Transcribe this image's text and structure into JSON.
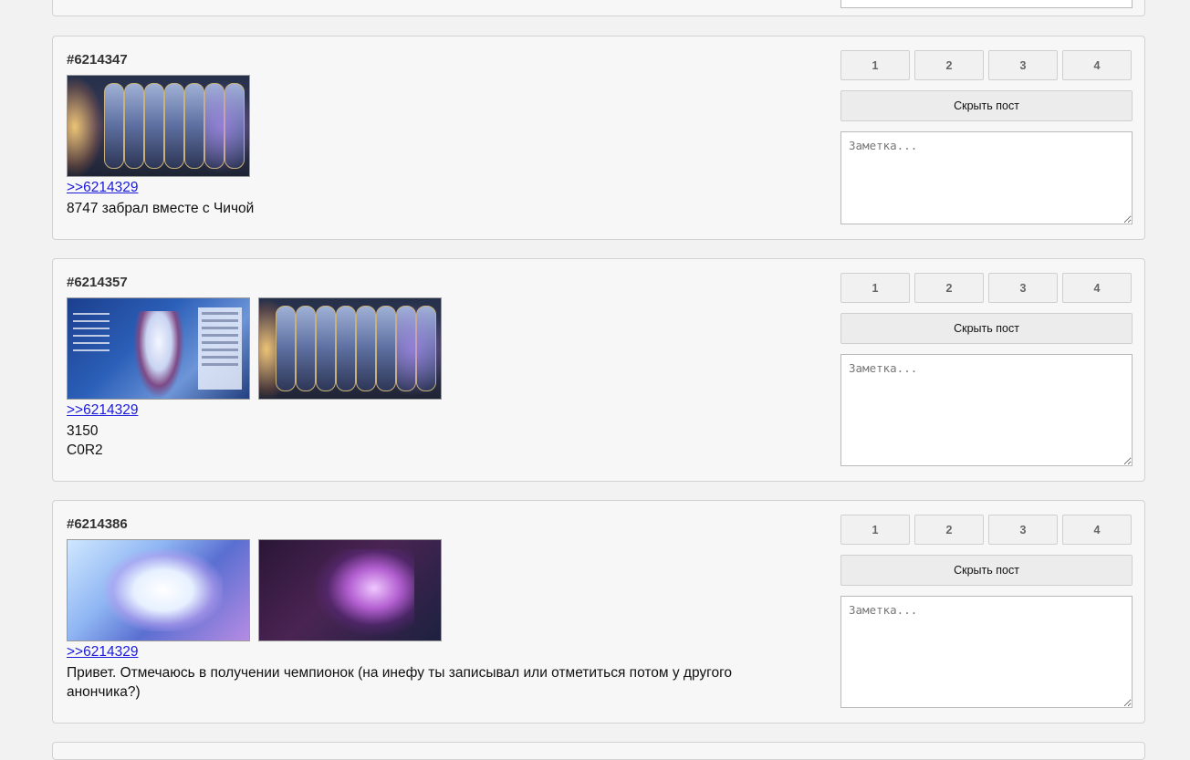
{
  "rating_buttons": [
    "1",
    "2",
    "3",
    "4"
  ],
  "hide_button_label": "Скрыть пост",
  "note_placeholder": "Заметка...",
  "posts": [
    {
      "id": "#6214347",
      "reply_link": ">>6214329",
      "lines": [
        "8747 забрал вместе с Чичой"
      ]
    },
    {
      "id": "#6214357",
      "reply_link": ">>6214329",
      "lines": [
        "3150",
        "C0R2"
      ]
    },
    {
      "id": "#6214386",
      "reply_link": ">>6214329",
      "lines": [
        "Привет. Отмечаюсь в получении чемпионок (на инефу ты записывал или отметиться потом у другого анончика?)"
      ]
    }
  ]
}
